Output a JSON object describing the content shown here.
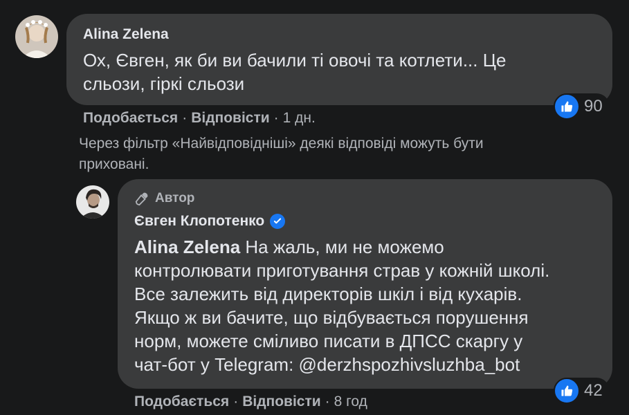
{
  "comment1": {
    "author": "Alina Zelena",
    "text_line1": "Ох, Євген, як би ви бачили ті овочі та котлети... Це",
    "text_line2": "сльози, гіркі сльози",
    "like_label": "Подобається",
    "reply_label": "Відповісти",
    "separator": "·",
    "time": "1 дн.",
    "reaction_count": "90"
  },
  "notice": {
    "line1": "Через фільтр «Найвідповідніші» деякі відповіді можуть бути",
    "line2": "приховані."
  },
  "reply": {
    "badge": "Автор",
    "author": "Євген Клопотенко",
    "mention": "Alina Zelena",
    "line1": "На жаль, ми не можемо",
    "line2": "контролювати приготування страв у кожній школі.",
    "line3": "Все залежить від директорів шкіл і від кухарів.",
    "line4": "Якщо ж ви бачите, що відбувається порушення",
    "line5": "норм, можете сміливо писати в ДПСС скаргу у",
    "line6": "чат-бот у Telegram: @derzhspozhivsluzhba_bot",
    "like_label": "Подобається",
    "reply_label": "Відповісти",
    "separator": "·",
    "time": "8 год",
    "reaction_count": "42"
  },
  "colors": {
    "background": "#18191a",
    "bubble": "#3a3b3c",
    "primary_text": "#e4e6eb",
    "secondary_text": "#b0b3b8",
    "like_blue": "#1877f2"
  }
}
